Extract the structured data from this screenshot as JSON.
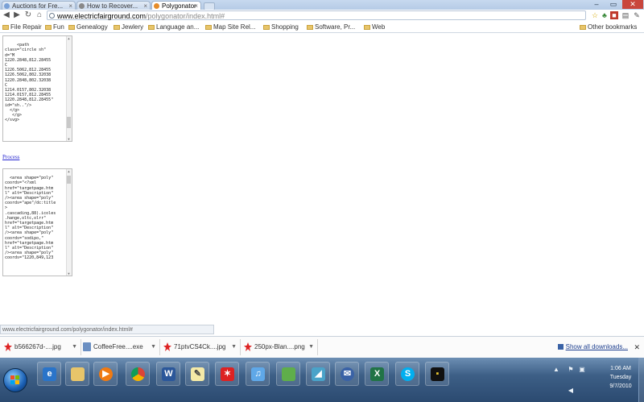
{
  "tabs": [
    {
      "label": "Auctions for Fre...",
      "active": false
    },
    {
      "label": "How to Recover...",
      "active": false
    },
    {
      "label": "Polygonator",
      "active": true
    }
  ],
  "toolbar": {
    "url_domain": "www.electricfairground.com",
    "url_path": "/polygonator/index.html#"
  },
  "bookmarks": [
    "File Repair",
    "Fun",
    "Genealogy",
    "Jewlery",
    "Language an...",
    "Map Site Rel...",
    "Shopping",
    "Software, Pr...",
    "Web"
  ],
  "other_bookmarks": "Other bookmarks",
  "page": {
    "svg_textarea": "   <path\nclass=\"circle sh\"\nd=\"M\n1220.2848,812.28455\nC\n1226.5062,812.28455\n1226.5062,802.32038\n1220.2848,802.32038\nC\n1214.0157,802.32038\n1214.0157,812.28455\n1220.2848,812.28455\"\nid=\"sh..\"/>\n  </g>\n   </g>\n</svg>",
    "process_link": "Process",
    "output_textarea": "<area shape=\"poly\"\ncoords=\"<?xml\nhref=\"targetpage.htm\nl\" alt=\"Description\"\n/><area shape=\"poly\"\ncoords=\"ape\"/dc:title\n>\n.cascading,88).icoles\n.hange,oltc,olrr\"\nhref=\"targetpage.htm\nl\" alt=\"Description\"\n/><area shape=\"poly\"\ncoords=\"sodipo,\"\nhref=\"targetpage.htm\nl\" alt=\"Description\"\n/><area shape=\"poly\"\ncoords=\"1220,849,123"
  },
  "status_url": "www.electricfairground.com/polygonator/index.html#",
  "downloads": [
    {
      "name": "b566267d-....jpg",
      "icon": "red-splat-icon"
    },
    {
      "name": "CoffeeFree....exe",
      "icon": "exe-file-icon"
    },
    {
      "name": "71ptvCS4Ck....jpg",
      "icon": "red-splat-icon"
    },
    {
      "name": "250px-Blan....png",
      "icon": "red-splat-icon"
    }
  ],
  "show_all_downloads": "Show all downloads...",
  "clock": {
    "time": "1:06 AM",
    "day": "Tuesday",
    "date": "9/7/2010"
  },
  "colors": {
    "taskbar": "#3d5f86",
    "link": "#2a2ad0",
    "accent_red": "#d22222"
  }
}
